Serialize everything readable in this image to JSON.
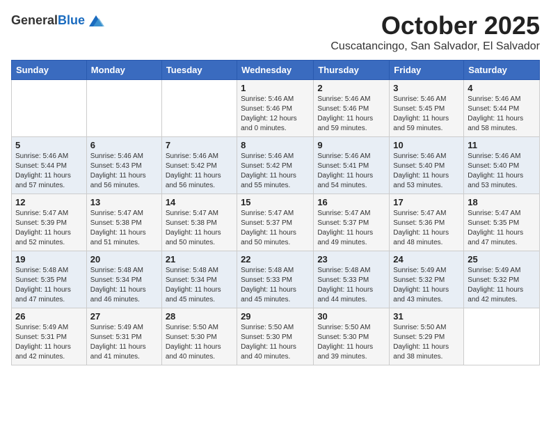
{
  "header": {
    "logo_general": "General",
    "logo_blue": "Blue",
    "month_title": "October 2025",
    "subtitle": "Cuscatancingo, San Salvador, El Salvador"
  },
  "days_of_week": [
    "Sunday",
    "Monday",
    "Tuesday",
    "Wednesday",
    "Thursday",
    "Friday",
    "Saturday"
  ],
  "weeks": [
    [
      {
        "day": "",
        "info": ""
      },
      {
        "day": "",
        "info": ""
      },
      {
        "day": "",
        "info": ""
      },
      {
        "day": "1",
        "info": "Sunrise: 5:46 AM\nSunset: 5:46 PM\nDaylight: 12 hours\nand 0 minutes."
      },
      {
        "day": "2",
        "info": "Sunrise: 5:46 AM\nSunset: 5:46 PM\nDaylight: 11 hours\nand 59 minutes."
      },
      {
        "day": "3",
        "info": "Sunrise: 5:46 AM\nSunset: 5:45 PM\nDaylight: 11 hours\nand 59 minutes."
      },
      {
        "day": "4",
        "info": "Sunrise: 5:46 AM\nSunset: 5:44 PM\nDaylight: 11 hours\nand 58 minutes."
      }
    ],
    [
      {
        "day": "5",
        "info": "Sunrise: 5:46 AM\nSunset: 5:44 PM\nDaylight: 11 hours\nand 57 minutes."
      },
      {
        "day": "6",
        "info": "Sunrise: 5:46 AM\nSunset: 5:43 PM\nDaylight: 11 hours\nand 56 minutes."
      },
      {
        "day": "7",
        "info": "Sunrise: 5:46 AM\nSunset: 5:42 PM\nDaylight: 11 hours\nand 56 minutes."
      },
      {
        "day": "8",
        "info": "Sunrise: 5:46 AM\nSunset: 5:42 PM\nDaylight: 11 hours\nand 55 minutes."
      },
      {
        "day": "9",
        "info": "Sunrise: 5:46 AM\nSunset: 5:41 PM\nDaylight: 11 hours\nand 54 minutes."
      },
      {
        "day": "10",
        "info": "Sunrise: 5:46 AM\nSunset: 5:40 PM\nDaylight: 11 hours\nand 53 minutes."
      },
      {
        "day": "11",
        "info": "Sunrise: 5:46 AM\nSunset: 5:40 PM\nDaylight: 11 hours\nand 53 minutes."
      }
    ],
    [
      {
        "day": "12",
        "info": "Sunrise: 5:47 AM\nSunset: 5:39 PM\nDaylight: 11 hours\nand 52 minutes."
      },
      {
        "day": "13",
        "info": "Sunrise: 5:47 AM\nSunset: 5:38 PM\nDaylight: 11 hours\nand 51 minutes."
      },
      {
        "day": "14",
        "info": "Sunrise: 5:47 AM\nSunset: 5:38 PM\nDaylight: 11 hours\nand 50 minutes."
      },
      {
        "day": "15",
        "info": "Sunrise: 5:47 AM\nSunset: 5:37 PM\nDaylight: 11 hours\nand 50 minutes."
      },
      {
        "day": "16",
        "info": "Sunrise: 5:47 AM\nSunset: 5:37 PM\nDaylight: 11 hours\nand 49 minutes."
      },
      {
        "day": "17",
        "info": "Sunrise: 5:47 AM\nSunset: 5:36 PM\nDaylight: 11 hours\nand 48 minutes."
      },
      {
        "day": "18",
        "info": "Sunrise: 5:47 AM\nSunset: 5:35 PM\nDaylight: 11 hours\nand 47 minutes."
      }
    ],
    [
      {
        "day": "19",
        "info": "Sunrise: 5:48 AM\nSunset: 5:35 PM\nDaylight: 11 hours\nand 47 minutes."
      },
      {
        "day": "20",
        "info": "Sunrise: 5:48 AM\nSunset: 5:34 PM\nDaylight: 11 hours\nand 46 minutes."
      },
      {
        "day": "21",
        "info": "Sunrise: 5:48 AM\nSunset: 5:34 PM\nDaylight: 11 hours\nand 45 minutes."
      },
      {
        "day": "22",
        "info": "Sunrise: 5:48 AM\nSunset: 5:33 PM\nDaylight: 11 hours\nand 45 minutes."
      },
      {
        "day": "23",
        "info": "Sunrise: 5:48 AM\nSunset: 5:33 PM\nDaylight: 11 hours\nand 44 minutes."
      },
      {
        "day": "24",
        "info": "Sunrise: 5:49 AM\nSunset: 5:32 PM\nDaylight: 11 hours\nand 43 minutes."
      },
      {
        "day": "25",
        "info": "Sunrise: 5:49 AM\nSunset: 5:32 PM\nDaylight: 11 hours\nand 42 minutes."
      }
    ],
    [
      {
        "day": "26",
        "info": "Sunrise: 5:49 AM\nSunset: 5:31 PM\nDaylight: 11 hours\nand 42 minutes."
      },
      {
        "day": "27",
        "info": "Sunrise: 5:49 AM\nSunset: 5:31 PM\nDaylight: 11 hours\nand 41 minutes."
      },
      {
        "day": "28",
        "info": "Sunrise: 5:50 AM\nSunset: 5:30 PM\nDaylight: 11 hours\nand 40 minutes."
      },
      {
        "day": "29",
        "info": "Sunrise: 5:50 AM\nSunset: 5:30 PM\nDaylight: 11 hours\nand 40 minutes."
      },
      {
        "day": "30",
        "info": "Sunrise: 5:50 AM\nSunset: 5:30 PM\nDaylight: 11 hours\nand 39 minutes."
      },
      {
        "day": "31",
        "info": "Sunrise: 5:50 AM\nSunset: 5:29 PM\nDaylight: 11 hours\nand 38 minutes."
      },
      {
        "day": "",
        "info": ""
      }
    ]
  ]
}
